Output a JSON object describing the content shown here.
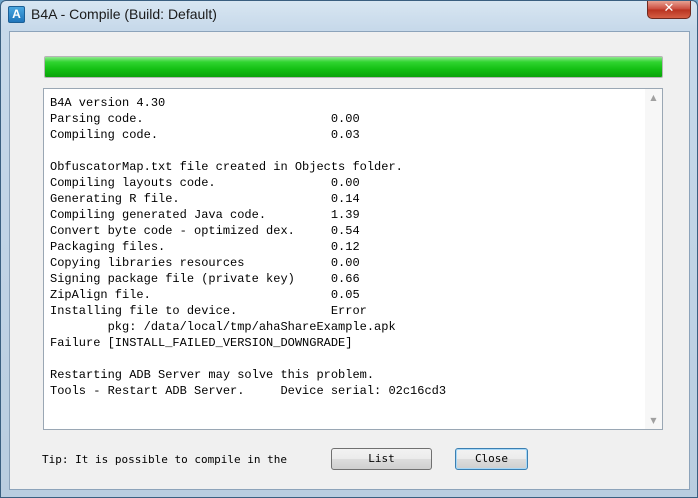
{
  "window": {
    "icon_glyph": "A",
    "title": "B4A - Compile (Build: Default)",
    "close_glyph": "✕"
  },
  "progress": {
    "fraction": 1.0
  },
  "log": {
    "lines": [
      "B4A version 4.30",
      "Parsing code.                          0.00",
      "Compiling code.                        0.03",
      "",
      "ObfuscatorMap.txt file created in Objects folder.",
      "Compiling layouts code.                0.00",
      "Generating R file.                     0.14",
      "Compiling generated Java code.         1.39",
      "Convert byte code - optimized dex.     0.54",
      "Packaging files.                       0.12",
      "Copying libraries resources            0.00",
      "Signing package file (private key)     0.66",
      "ZipAlign file.                         0.05",
      "Installing file to device.             Error",
      "        pkg: /data/local/tmp/ahaShareExample.apk",
      "Failure [INSTALL_FAILED_VERSION_DOWNGRADE]",
      "",
      "Restarting ADB Server may solve this problem.",
      "Tools - Restart ADB Server.     Device serial: 02c16cd3"
    ],
    "scroll_up_glyph": "▲",
    "scroll_down_glyph": "▼"
  },
  "footer": {
    "tip": "Tip: It is possible to compile in the",
    "list_label": "List",
    "close_label": "Close"
  }
}
